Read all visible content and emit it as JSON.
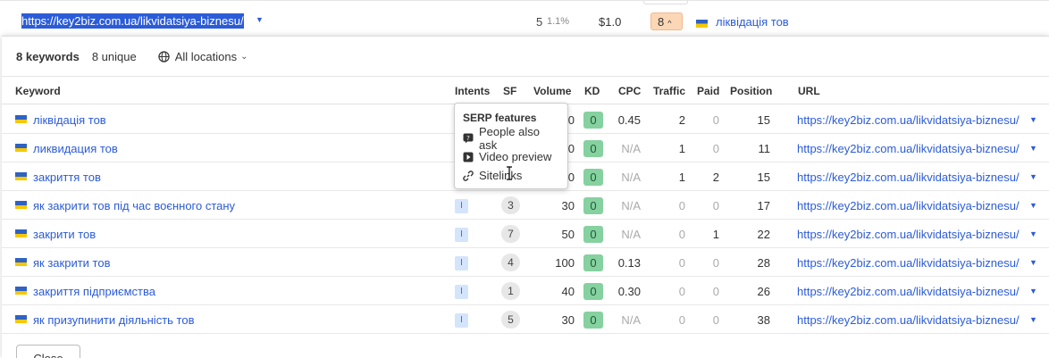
{
  "top_row": {
    "url": "https://key2biz.com.ua/likvidatsiya-biznesu/",
    "volume": "5",
    "volume_pct": "1.1%",
    "cpc": "$1.0",
    "badge": "8",
    "keyword": "ліквідація тов"
  },
  "summary": {
    "keywords": "8 keywords",
    "unique": "8 unique",
    "locations": "All locations"
  },
  "table": {
    "headers": {
      "keyword": "Keyword",
      "intents": "Intents",
      "sf": "SF",
      "volume": "Volume",
      "kd": "KD",
      "cpc": "CPC",
      "traffic": "Traffic",
      "paid": "Paid",
      "position": "Position",
      "url": "URL"
    },
    "rows": [
      {
        "keyword": "ліквідація тов",
        "intent": "",
        "sf": "",
        "volume": "0",
        "kd": "0",
        "cpc": "0.45",
        "traffic": "2",
        "paid": "0",
        "position": "15",
        "url": "https://key2biz.com.ua/likvidatsiya-biznesu/"
      },
      {
        "keyword": "ликвидация тов",
        "intent": "",
        "sf": "",
        "volume": "0",
        "kd": "0",
        "cpc": "N/A",
        "traffic": "1",
        "paid": "0",
        "position": "11",
        "url": "https://key2biz.com.ua/likvidatsiya-biznesu/"
      },
      {
        "keyword": "закриття тов",
        "intent": "",
        "sf": "",
        "volume": "0",
        "kd": "0",
        "cpc": "N/A",
        "traffic": "1",
        "paid": "2",
        "position": "15",
        "url": "https://key2biz.com.ua/likvidatsiya-biznesu/"
      },
      {
        "keyword": "як закрити тов під час воєнного стану",
        "intent": "I",
        "sf": "3",
        "volume": "30",
        "kd": "0",
        "cpc": "N/A",
        "traffic": "0",
        "paid": "0",
        "position": "17",
        "url": "https://key2biz.com.ua/likvidatsiya-biznesu/"
      },
      {
        "keyword": "закрити тов",
        "intent": "I",
        "sf": "7",
        "volume": "50",
        "kd": "0",
        "cpc": "N/A",
        "traffic": "0",
        "paid": "1",
        "position": "22",
        "url": "https://key2biz.com.ua/likvidatsiya-biznesu/"
      },
      {
        "keyword": "як закрити тов",
        "intent": "I",
        "sf": "4",
        "volume": "100",
        "kd": "0",
        "cpc": "0.13",
        "traffic": "0",
        "paid": "0",
        "position": "28",
        "url": "https://key2biz.com.ua/likvidatsiya-biznesu/"
      },
      {
        "keyword": "закриття підприємства",
        "intent": "I",
        "sf": "1",
        "volume": "40",
        "kd": "0",
        "cpc": "0.30",
        "traffic": "0",
        "paid": "0",
        "position": "26",
        "url": "https://key2biz.com.ua/likvidatsiya-biznesu/"
      },
      {
        "keyword": "як призупинити діяльність тов",
        "intent": "I",
        "sf": "5",
        "volume": "30",
        "kd": "0",
        "cpc": "N/A",
        "traffic": "0",
        "paid": "0",
        "position": "38",
        "url": "https://key2biz.com.ua/likvidatsiya-biznesu/"
      }
    ]
  },
  "tooltip": {
    "title": "SERP features",
    "items": [
      {
        "label": "People also ask",
        "icon": "question-bubble-icon"
      },
      {
        "label": "Video preview",
        "icon": "play-icon"
      },
      {
        "label": "Sitelinks",
        "icon": "link-icon"
      }
    ]
  },
  "close_label": "Close",
  "colors": {
    "link": "#2b5bd7",
    "kd_easy": "#86d1a0",
    "intent_informational": "#d4e4fb",
    "badge_orange": "#fbd7b6",
    "flag_blue": "#2f62c3",
    "flag_yellow": "#f5c800"
  }
}
